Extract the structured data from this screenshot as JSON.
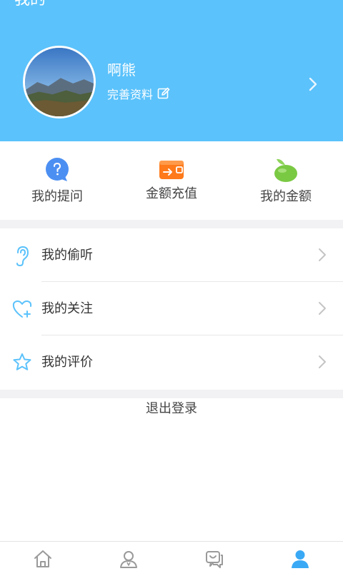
{
  "header": {
    "title": "我的",
    "username": "啊熊",
    "profile_link": "完善资料",
    "background_color": "#5bc2fb"
  },
  "quick_actions": [
    {
      "label": "我的提问",
      "icon": "question-bubble-icon",
      "color": "#4c8ff2"
    },
    {
      "label": "金额充值",
      "icon": "wallet-icon",
      "color": "#ff7a1a"
    },
    {
      "label": "我的金额",
      "icon": "bean-icon",
      "color": "#7ac943"
    }
  ],
  "menu": [
    {
      "label": "我的偷听",
      "icon": "ear-icon"
    },
    {
      "label": "我的关注",
      "icon": "heart-plus-icon"
    },
    {
      "label": "我的评价",
      "icon": "star-icon"
    }
  ],
  "logout_label": "退出登录",
  "tabbar": {
    "tabs": [
      {
        "icon": "home-icon",
        "active": false
      },
      {
        "icon": "user-search-icon",
        "active": false
      },
      {
        "icon": "chat-icon",
        "active": false
      },
      {
        "icon": "profile-icon",
        "active": true
      }
    ],
    "active_color": "#3aa9f5",
    "inactive_color": "#9a9a9a"
  }
}
